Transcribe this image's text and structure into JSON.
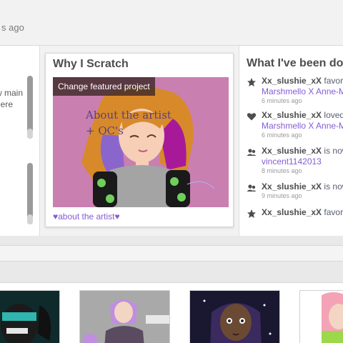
{
  "top": {
    "time_ago": "s ago"
  },
  "left_panel": {
    "line1": "w main",
    "line2": "here"
  },
  "why_scratch": {
    "title": "Why I Scratch",
    "change_button": "Change featured project",
    "art_caption_line1": "About the artist",
    "art_caption_line2": "+ OC's",
    "link": "♥about the artist♥"
  },
  "activity": {
    "title": "What I've been doi",
    "items": [
      {
        "icon": "star-icon",
        "user": "Xx_slushie_xX",
        "action": "favorit",
        "target": "Marshmello X Anne-Ma",
        "time": "6 minutes ago"
      },
      {
        "icon": "heart-icon",
        "user": "Xx_slushie_xX",
        "action": "loved I",
        "target": "Marshmello X Anne-Ma",
        "time": "6 minutes ago"
      },
      {
        "icon": "people-icon",
        "user": "Xx_slushie_xX",
        "action": "is now",
        "target": "vincent1142013",
        "time": "8 minutes ago"
      },
      {
        "icon": "people-icon",
        "user": "Xx_slushie_xX",
        "action": "is now",
        "target": "",
        "time": "9 minutes ago"
      },
      {
        "icon": "star-icon",
        "user": "Xx_slushie_xX",
        "action": "favorit",
        "target": "",
        "time": ""
      }
    ]
  },
  "colors": {
    "link": "#855cd6",
    "featured_bg": "#c97fb0"
  }
}
